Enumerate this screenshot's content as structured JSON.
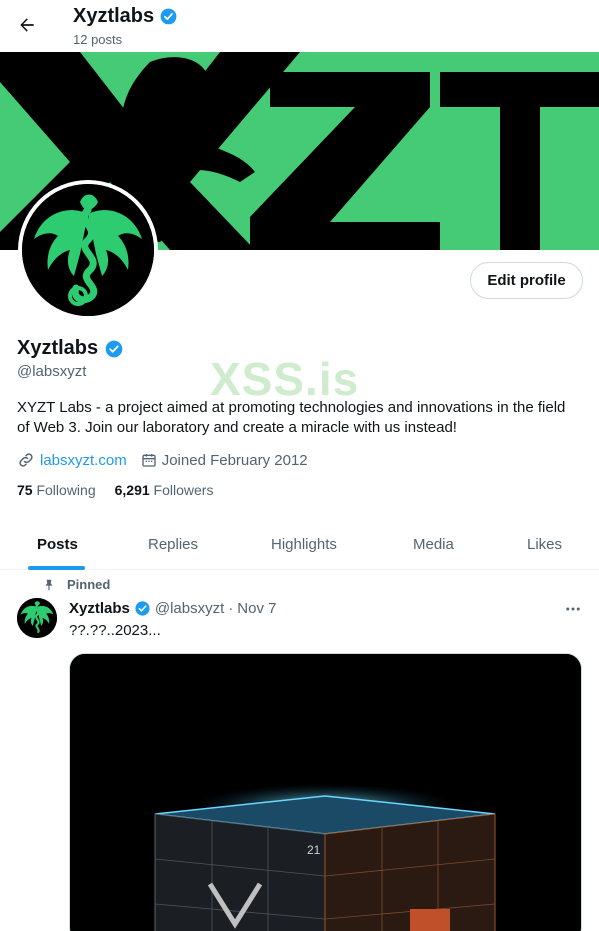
{
  "header": {
    "title": "Xyztlabs",
    "posts_count": "12 posts"
  },
  "banner": {
    "text": "XYZT"
  },
  "profile": {
    "edit_label": "Edit profile",
    "name": "Xyztlabs",
    "handle": "@labsxyzt",
    "bio": "XYZT Labs - a project aimed at promoting technologies and innovations in the field of Web 3. Join our laboratory and create a miracle with us instead!",
    "website": "labsxyzt.com",
    "joined": "Joined February 2012",
    "following_count": "75",
    "following_label": "Following",
    "followers_count": "6,291",
    "followers_label": "Followers",
    "watermark": "XSS.is"
  },
  "tabs": [
    {
      "label": "Posts"
    },
    {
      "label": "Replies"
    },
    {
      "label": "Highlights"
    },
    {
      "label": "Media"
    },
    {
      "label": "Likes"
    }
  ],
  "pinned_post": {
    "pinned_label": "Pinned",
    "name": "Xyztlabs",
    "handle": "@labsxyzt",
    "separator": "·",
    "date": "Nov 7",
    "text": "??.??..2023...",
    "media_label": "21"
  },
  "colors": {
    "accent": "#1d9bf0",
    "banner_green": "#45cb75",
    "verified": "#1d9bf0"
  },
  "icons": [
    "arrow-left-icon",
    "verified-badge-icon",
    "link-icon",
    "calendar-icon",
    "pin-icon",
    "more-icon"
  ]
}
